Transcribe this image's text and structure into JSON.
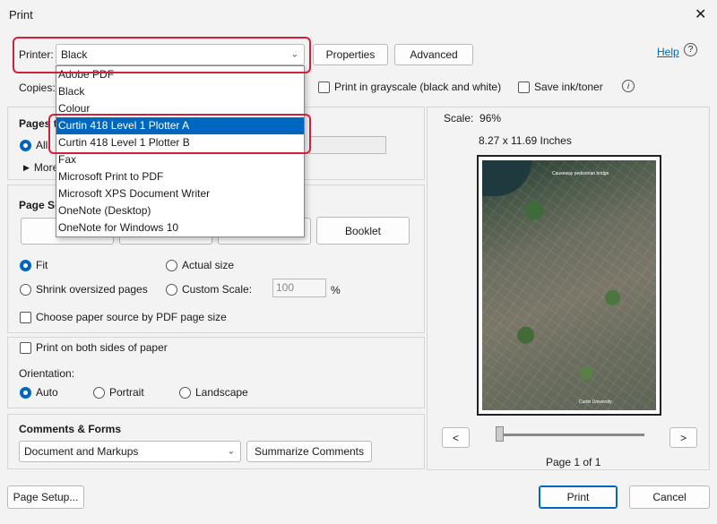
{
  "window": {
    "title": "Print",
    "close_glyph": "✕"
  },
  "printer": {
    "label": "Printer:",
    "selected": "Black",
    "properties_label": "Properties",
    "advanced_label": "Advanced",
    "help_label": "Help",
    "help_glyph": "?",
    "options": [
      "Adobe PDF",
      "Black",
      "Colour",
      "Curtin 418 Level 1 Plotter A",
      "Curtin 418 Level 1 Plotter B",
      "Fax",
      "Microsoft Print to PDF",
      "Microsoft XPS Document Writer",
      "OneNote (Desktop)",
      "OneNote for Windows 10"
    ],
    "highlighted_index": 3
  },
  "copies": {
    "label": "Copies:",
    "grayscale_label": "Print in grayscale (black and white)",
    "save_ink_label": "Save ink/toner",
    "info_glyph": "i"
  },
  "pages": {
    "title_partial": "Pages t",
    "all_partial": "All",
    "more_partial": "More"
  },
  "page_sizing": {
    "title_partial": "Page Si",
    "booklet_label": "Booklet",
    "fit_label": "Fit",
    "actual_size_label": "Actual size",
    "shrink_label": "Shrink oversized pages",
    "custom_scale_label": "Custom Scale:",
    "custom_scale_value": "100",
    "percent": "%",
    "paper_source_label": "Choose paper source by PDF page size"
  },
  "duplex": {
    "label": "Print on both sides of paper"
  },
  "orientation": {
    "label": "Orientation:",
    "auto": "Auto",
    "portrait": "Portrait",
    "landscape": "Landscape"
  },
  "comments": {
    "title": "Comments & Forms",
    "selected": "Document and Markups",
    "summarize_label": "Summarize Comments"
  },
  "preview": {
    "scale_text": "Scale:  96%",
    "size_text": "8.27 x 11.69 Inches",
    "map_caption_top": "Causeway pedestrian bridge",
    "map_caption_bottom": "Curtin University",
    "prev_glyph": "<",
    "next_glyph": ">",
    "page_text": "Page 1 of 1"
  },
  "footer": {
    "page_setup_label": "Page Setup...",
    "print_label": "Print",
    "cancel_label": "Cancel"
  },
  "colors": {
    "accent": "#0067c0",
    "highlight_red": "#d21f3c"
  }
}
